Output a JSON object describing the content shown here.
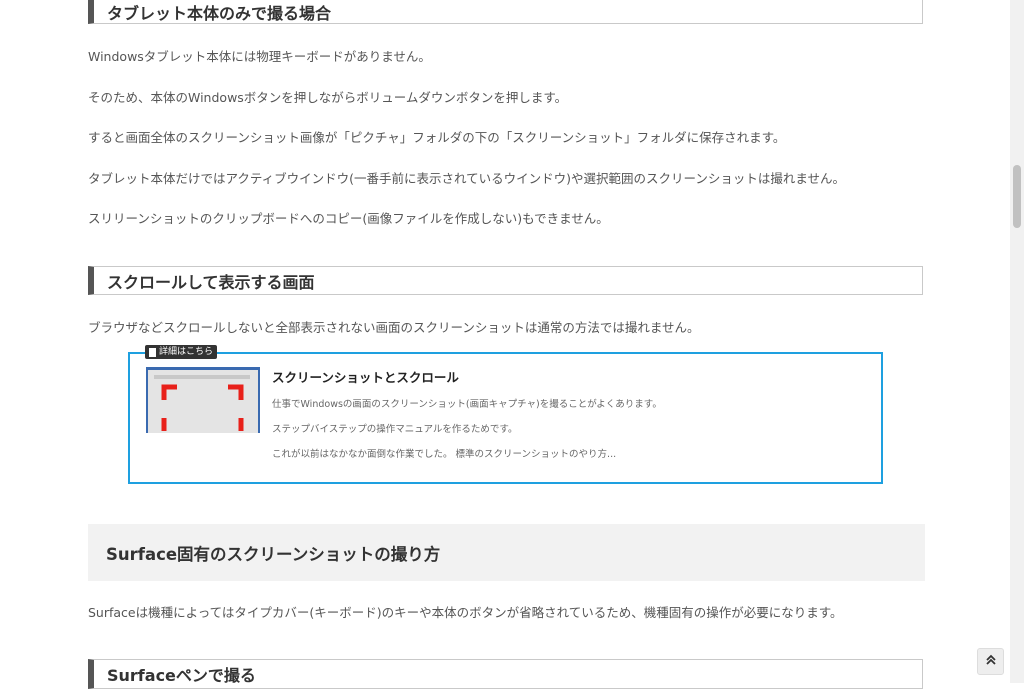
{
  "headings": {
    "h3_tablet": "タブレット本体のみで撮る場合",
    "h3_scroll": "スクロールして表示する画面",
    "h2_surface": "Surface固有のスクリーンショットの撮り方",
    "h3_pen": "Surfaceペンで撮る"
  },
  "paragraphs": {
    "p1": "Windowsタブレット本体には物理キーボードがありません。",
    "p2": "そのため、本体のWindowsボタンを押しながらボリュームダウンボタンを押します。",
    "p3": "すると画面全体のスクリーンショット画像が「ピクチャ」フォルダの下の「スクリーンショット」フォルダに保存されます。",
    "p4": "タブレット本体だけではアクティブウインドウ(一番手前に表示されているウインドウ)や選択範囲のスクリーンショットは撮れません。",
    "p5": "スリリーンショットのクリップボードへのコピー(画像ファイルを作成しない)もできません。",
    "p6": "ブラウザなどスクロールしないと全部表示されない画面のスクリーンショットは通常の方法では撮れません。",
    "p7": "Surfaceは機種によってはタイプカバー(キーボード)のキーや本体のボタンが省略されているため、機種固有の操作が必要になります。"
  },
  "card": {
    "badge": "詳細はこちら",
    "title": "スクリーンショットとスクロール",
    "line1": "仕事でWindowsの画面のスクリーンショット(画面キャプチャ)を撮ることがよくあります。",
    "line2": "ステップバイステップの操作マニュアルを作るためです。",
    "line3": "これが以前はなかなか面倒な作業でした。 標準のスクリーンショットのやり方..."
  },
  "controls": {
    "back_to_top": "«",
    "doc_icon": "document-icon"
  },
  "colors": {
    "card_border": "#1ea0e0",
    "heading_bar": "#555555",
    "thumb_bracket": "#e8201a"
  }
}
